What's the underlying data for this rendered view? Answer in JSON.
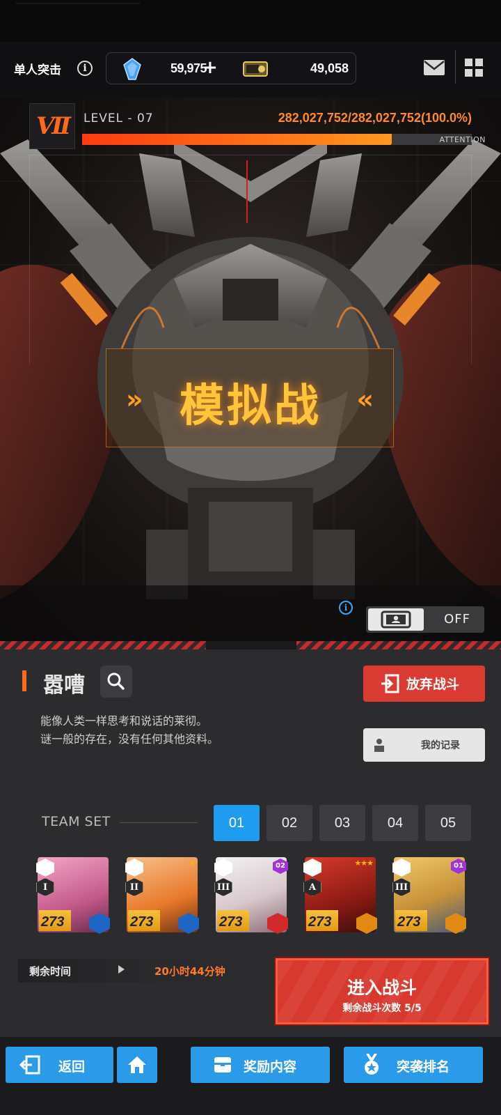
{
  "header": {
    "mode_label": "单人突击",
    "gems": "59,975",
    "plus": "+",
    "credits": "49,058"
  },
  "boss": {
    "level_badge": "VII",
    "level_text": "LEVEL - 07",
    "hp_text": "282,027,752/282,027,752(100.0%)",
    "hp_fraction": 1.0,
    "attention": "ATTENTION",
    "center_title": "模拟战",
    "auto_state": "OFF"
  },
  "info": {
    "name": "嚣嘈",
    "description_line1": "能像人类一样思考和说话的莱彻。",
    "description_line2": "谜一般的存在，没有任何其他资料。",
    "quit_label": "放弃战斗",
    "record_label": "我的记录"
  },
  "team": {
    "label": "TEAM SET",
    "tabs": [
      "01",
      "02",
      "03",
      "04",
      "05"
    ],
    "active_tab": 0,
    "characters": [
      {
        "burst": "I",
        "level": "273",
        "element": "water",
        "element_color": "#1f66c4",
        "rank": ""
      },
      {
        "burst": "II",
        "level": "273",
        "element": "water",
        "element_color": "#1f66c4",
        "rank": ""
      },
      {
        "burst": "III",
        "level": "273",
        "element": "fire",
        "element_color": "#d22a2a",
        "rank": "02"
      },
      {
        "burst": "A",
        "level": "273",
        "element": "wind",
        "element_color": "#e08a12",
        "rank": ""
      },
      {
        "burst": "III",
        "level": "273",
        "element": "wind",
        "element_color": "#e08a12",
        "rank": "01"
      }
    ]
  },
  "battle": {
    "time_label": "剩余时间",
    "time_value": "20小时44分钟",
    "enter_label": "进入战斗",
    "remaining_label": "剩余战斗次数  5/5"
  },
  "nav": {
    "back": "返回",
    "rewards": "奖励内容",
    "ranking": "突袭排名"
  },
  "colors": {
    "accent_orange": "#ff6a1a",
    "primary_blue": "#2b9ae8",
    "danger_red": "#d93a32"
  }
}
